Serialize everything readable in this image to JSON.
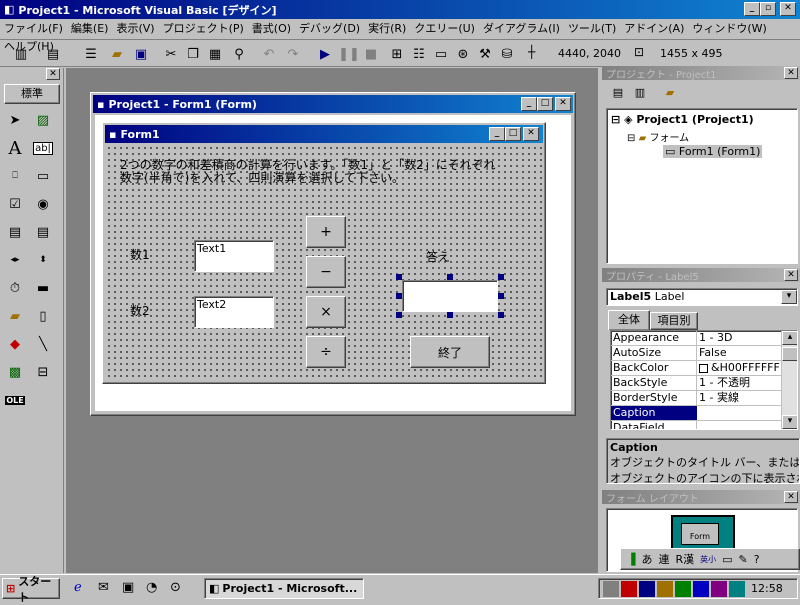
{
  "app": {
    "title": "Project1 - Microsoft Visual Basic [デザイン]"
  },
  "menu": [
    "ファイル(F)",
    "編集(E)",
    "表示(V)",
    "プロジェクト(P)",
    "書式(O)",
    "デバッグ(D)",
    "実行(R)",
    "クエリー(U)",
    "ダイアグラム(I)",
    "ツール(T)",
    "アドイン(A)",
    "ウィンドウ(W)",
    "ヘルプ(H)"
  ],
  "toolbar": {
    "position": "4440, 2040",
    "size": "1455 x 495"
  },
  "toolbox": {
    "title": "標準"
  },
  "designer": {
    "title": "Project1 - Form1 (Form)"
  },
  "form": {
    "title": "Form1",
    "instructions_line1": "2つの数字の和差積商の計算を行います。「数1」と「数2」にそれぞれ",
    "instructions_line2": "数字(半角で)を入れて、四則演算を選択して下さい。",
    "label1": "数1",
    "label2": "数2",
    "text1": "Text1",
    "text2": "Text2",
    "op_add": "+",
    "op_sub": "−",
    "op_mul": "×",
    "op_div": "÷",
    "answer_label": "答え",
    "exit_button": "終了"
  },
  "project_explorer": {
    "title": "プロジェクト - Project1",
    "root": "Project1 (Project1)",
    "folder": "フォーム",
    "form_item": "Form1 (Form1)"
  },
  "properties": {
    "title": "プロパティ - Label5",
    "object": "Label5",
    "object_type": "Label",
    "tab_all": "全体",
    "tab_category": "項目別",
    "rows": [
      {
        "name": "Appearance",
        "value": "1 - 3D"
      },
      {
        "name": "AutoSize",
        "value": "False"
      },
      {
        "name": "BackColor",
        "value": "&H00FFFFFF"
      },
      {
        "name": "BackStyle",
        "value": "1 - 不透明"
      },
      {
        "name": "BorderStyle",
        "value": "1 - 実線"
      },
      {
        "name": "Caption",
        "value": ""
      },
      {
        "name": "DataField",
        "value": ""
      }
    ],
    "desc_title": "Caption",
    "desc_line1": "オブジェクトのタイトル バー、または",
    "desc_line2": "オブジェクトのアイコンの下に表示される文"
  },
  "form_layout": {
    "title": "フォーム レイアウト",
    "preview_label": "Form"
  },
  "ime": {
    "items": [
      "あ",
      "連",
      "R漢",
      "英小"
    ]
  },
  "taskbar": {
    "start": "スタート",
    "task": "Project1 - Microsoft...",
    "clock": "12:58"
  },
  "colors": {
    "title_active": "#000080",
    "face": "#c0c0c0",
    "desktop": "#808080"
  }
}
